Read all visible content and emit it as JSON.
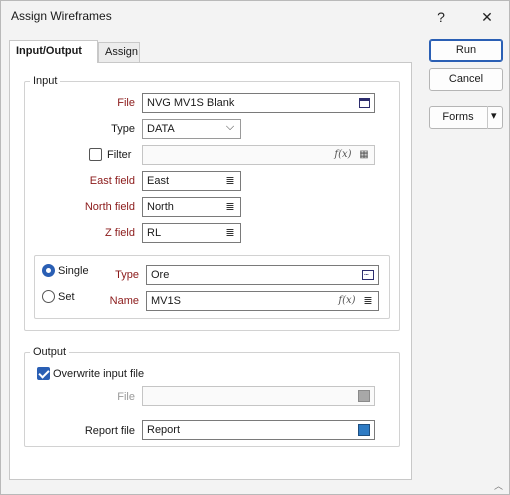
{
  "window": {
    "title": "Assign Wireframes",
    "help_glyph": "?",
    "close_glyph": "✕"
  },
  "tabs": [
    {
      "label": "Input/Output"
    },
    {
      "label": "Assign"
    }
  ],
  "buttons": {
    "run": "Run",
    "cancel": "Cancel",
    "forms": "Forms",
    "forms_arrow": "▾"
  },
  "input_group": {
    "legend": "Input",
    "file": {
      "label": "File",
      "value": "NVG MV1S Blank"
    },
    "type": {
      "label": "Type",
      "value": "DATA",
      "arrow": "⌵"
    },
    "filter": {
      "label": "Filter",
      "checked": false,
      "value": "",
      "fx": "f(x)"
    },
    "east": {
      "label": "East field",
      "value": "East"
    },
    "north": {
      "label": "North field",
      "value": "North"
    },
    "z": {
      "label": "Z field",
      "value": "RL"
    },
    "mode": {
      "single": {
        "label": "Single",
        "selected": true
      },
      "set": {
        "label": "Set",
        "selected": false
      }
    },
    "wf_type": {
      "label": "Type",
      "value": "Ore"
    },
    "wf_name": {
      "label": "Name",
      "value": "MV1S",
      "fx": "f(x)"
    }
  },
  "output_group": {
    "legend": "Output",
    "overwrite": {
      "label": "Overwrite input file",
      "checked": true
    },
    "file": {
      "label": "File",
      "value": ""
    },
    "report": {
      "label": "Report file",
      "value": "Report"
    }
  },
  "list_glyph": "≣",
  "grip_glyph": "︿"
}
